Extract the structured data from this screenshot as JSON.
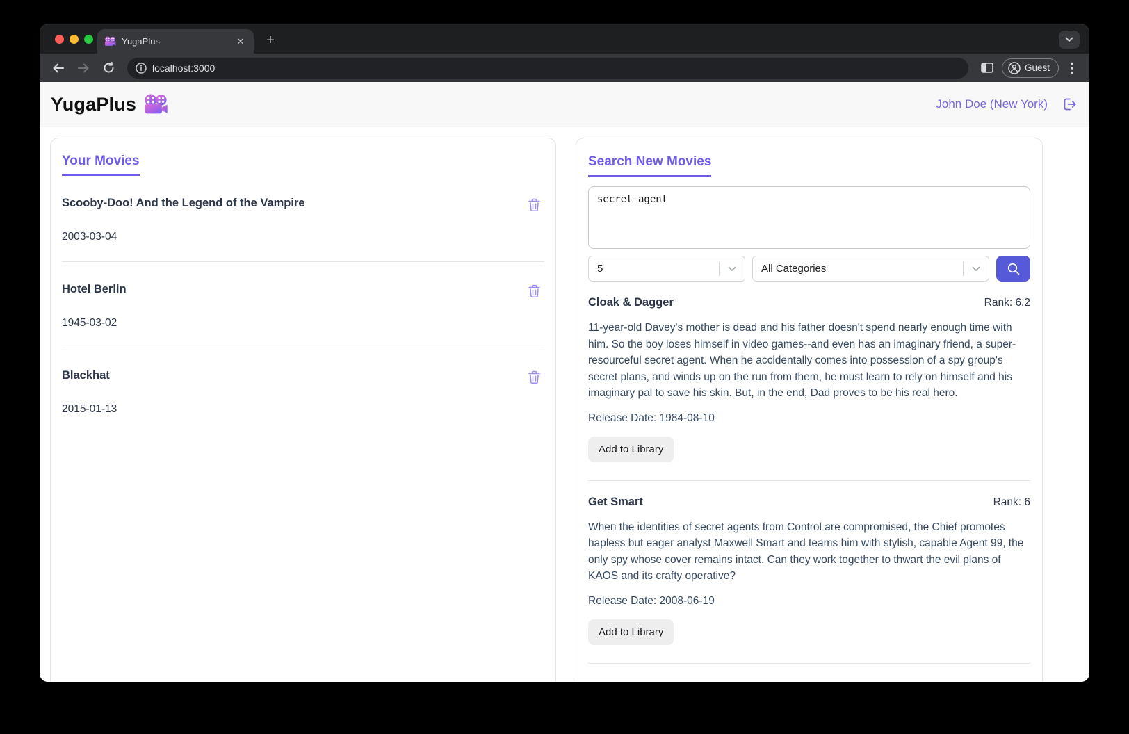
{
  "colors": {
    "accent_purple": "#6c5ce7",
    "user_link_purple": "#7668dd",
    "trash_purple": "#9b8ff5",
    "search_button_indigo": "#575ad8",
    "title_dark": "#2b3648",
    "body_text": "#364a60"
  },
  "browser": {
    "tab_title": "YugaPlus",
    "tab_close_glyph": "✕",
    "new_tab_glyph": "+",
    "url": "localhost:3000",
    "guest_label": "Guest"
  },
  "header": {
    "app_title": "YugaPlus",
    "user_name": "John Doe (New York)"
  },
  "library": {
    "heading": "Your Movies",
    "movies": [
      {
        "title": "Scooby-Doo! And the Legend of the Vampire",
        "date": "2003-03-04"
      },
      {
        "title": "Hotel Berlin",
        "date": "1945-03-02"
      },
      {
        "title": "Blackhat",
        "date": "2015-01-13"
      }
    ]
  },
  "search": {
    "heading": "Search New Movies",
    "query": "secret agent",
    "limit_value": "5",
    "category_value": "All Categories",
    "results": [
      {
        "title": "Cloak & Dagger",
        "rank_label": "Rank: 6.2",
        "description": "11-year-old Davey's mother is dead and his father doesn't spend nearly enough time with him. So the boy loses himself in video games--and even has an imaginary friend, a super-resourceful secret agent. When he accidentally comes into possession of a spy group's secret plans, and winds up on the run from them, he must learn to rely on himself and his imaginary pal to save his skin. But, in the end, Dad proves to be his real hero.",
        "release_label": "Release Date: 1984-08-10",
        "add_label": "Add to Library"
      },
      {
        "title": "Get Smart",
        "rank_label": "Rank: 6",
        "description": "When the identities of secret agents from Control are compromised, the Chief promotes hapless but eager analyst Maxwell Smart and teams him with stylish, capable Agent 99, the only spy whose cover remains intact. Can they work together to thwart the evil plans of KAOS and its crafty operative?",
        "release_label": "Release Date: 2008-06-19",
        "add_label": "Add to Library"
      }
    ]
  }
}
